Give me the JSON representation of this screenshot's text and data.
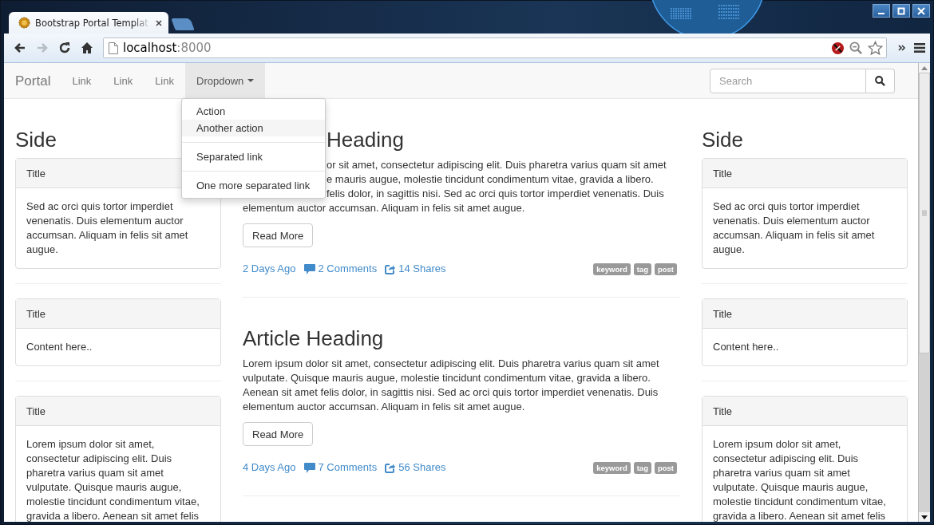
{
  "browser": {
    "tab_title": "Bootstrap Portal Templat",
    "url_host": "localhost",
    "url_port": ":8000",
    "toolbar_buttons": [
      {
        "kind": "back",
        "disabled": false
      },
      {
        "kind": "forward",
        "disabled": true
      },
      {
        "kind": "reload",
        "disabled": false
      },
      {
        "kind": "home",
        "disabled": false
      }
    ]
  },
  "navbar": {
    "brand": "Portal",
    "items": [
      {
        "label": "Link",
        "kind": "link"
      },
      {
        "label": "Link",
        "kind": "link"
      },
      {
        "label": "Link",
        "kind": "link"
      },
      {
        "label": "Dropdown",
        "kind": "dropdown",
        "open": true
      }
    ],
    "search": {
      "placeholder": "Search"
    }
  },
  "dropdown_menu": [
    {
      "kind": "item",
      "label": "Action",
      "highlighted": false
    },
    {
      "kind": "item",
      "label": "Another action",
      "highlighted": true
    },
    {
      "kind": "divider"
    },
    {
      "kind": "item",
      "label": "Separated link",
      "highlighted": false
    },
    {
      "kind": "divider"
    },
    {
      "kind": "item",
      "label": "One more separated link",
      "highlighted": false
    }
  ],
  "left_sidebar": {
    "heading": "Side",
    "panels": [
      {
        "title": "Title",
        "body": "Sed ac orci quis tortor imperdiet venenatis. Duis elementum auctor accumsan. Aliquam in felis sit amet augue."
      },
      {
        "title": "Title",
        "body": "Content here.."
      },
      {
        "title": "Title",
        "body": "Lorem ipsum dolor sit amet, consectetur adipiscing elit. Duis pharetra varius quam sit amet vulputate. Quisque mauris augue, molestie tincidunt condimentum vitae, gravida a libero. Aenean sit amet felis"
      }
    ]
  },
  "articles": [
    {
      "kind": "partly_covered",
      "heading": "Heading",
      "lines": [
        {
          "text": "or sit amet, consectetur adipiscing elit. Duis pharetra varius quam sit amet",
          "covered": true
        },
        {
          "text": "e mauris augue, molestie tincidunt condimentum vitae, gravida a libero.",
          "covered": true
        },
        {
          "text": "felis dolor, in sagittis nisi. Sed ac orci quis tortor imperdiet venenatis. Duis",
          "covered": true
        },
        {
          "text": "elementum auctor accumsan. Aliquam in felis sit amet augue.",
          "covered": false
        }
      ],
      "button": "Read More",
      "date": "2 Days Ago",
      "comments": "2 Comments",
      "shares": "14 Shares",
      "tags": [
        "keyword",
        "tag",
        "post"
      ]
    },
    {
      "kind": "full",
      "heading": "Article Heading",
      "text": "Lorem ipsum dolor sit amet, consectetur adipiscing elit. Duis pharetra varius quam sit amet vulputate. Quisque mauris augue, molestie tincidunt condimentum vitae, gravida a libero. Aenean sit amet felis dolor, in sagittis nisi. Sed ac orci quis tortor imperdiet venenatis. Duis elementum auctor accumsan. Aliquam in felis sit amet augue.",
      "button": "Read More",
      "date": "4 Days Ago",
      "comments": "7 Comments",
      "shares": "56 Shares",
      "tags": [
        "keyword",
        "tag",
        "post"
      ]
    }
  ],
  "right_sidebar": {
    "heading": "Side",
    "panels": [
      {
        "title": "Title",
        "body": "Sed ac orci quis tortor imperdiet venenatis. Duis elementum auctor accumsan. Aliquam in felis sit amet augue."
      },
      {
        "title": "Title",
        "body": "Content here.."
      },
      {
        "title": "Title",
        "body": "Lorem ipsum dolor sit amet, consectetur adipiscing elit. Duis pharetra varius quam sit amet vulputate. Quisque mauris augue, molestie tincidunt condimentum vitae, gravida a libero. Aenean sit amet felis"
      }
    ]
  }
}
